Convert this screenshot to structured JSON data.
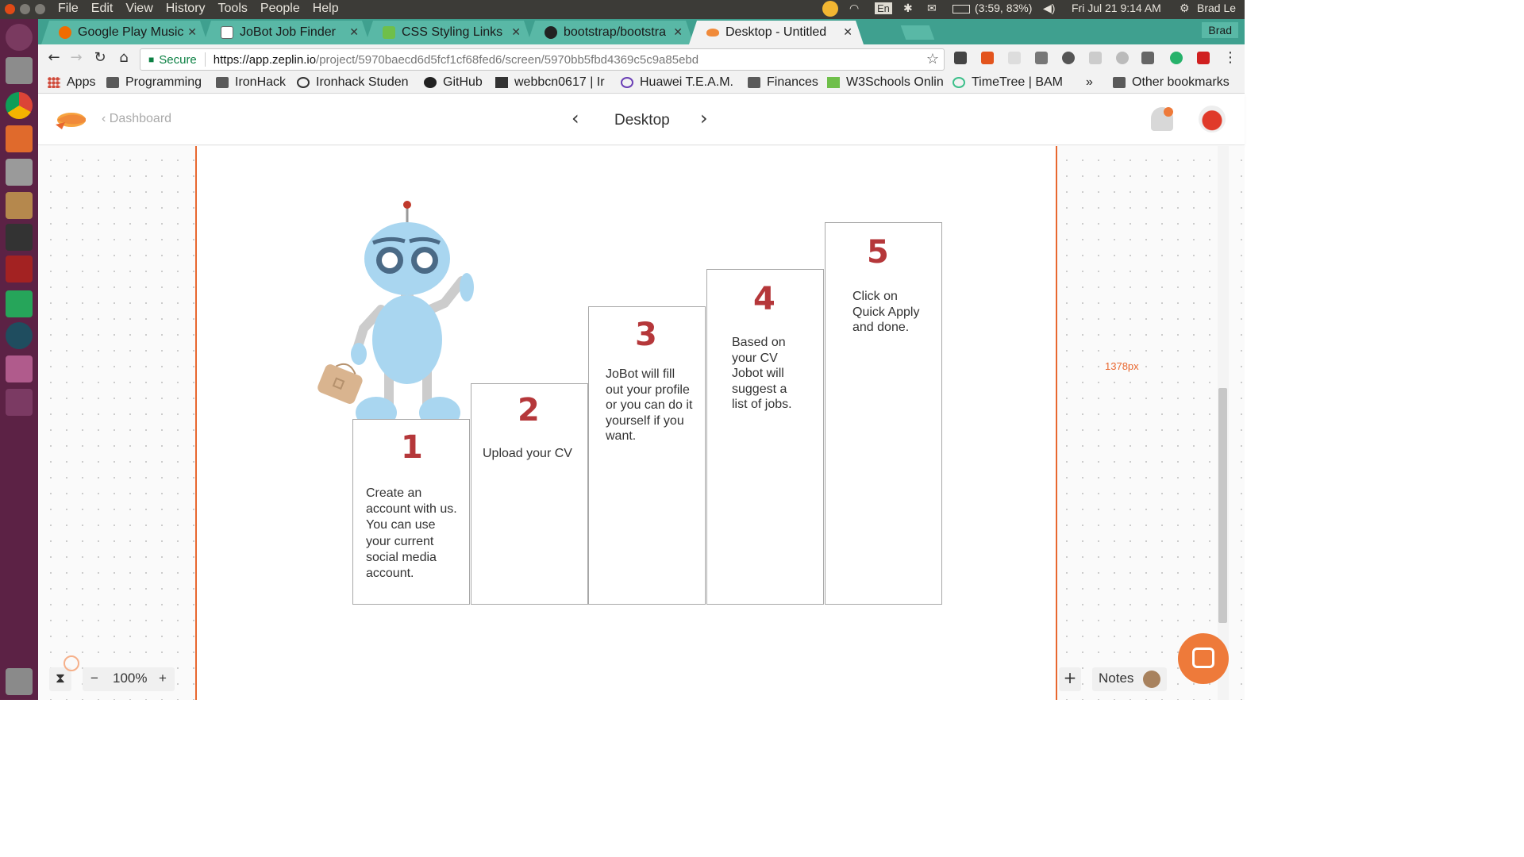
{
  "os": {
    "menus": [
      "File",
      "Edit",
      "View",
      "History",
      "Tools",
      "People",
      "Help"
    ],
    "keyboard": "En",
    "battery": "(3:59, 83%)",
    "datetime": "Fri Jul 21  9:14 AM",
    "user": "Brad Le"
  },
  "tabs": [
    {
      "label": "Google Play Music",
      "icon_color": "#ef6c00"
    },
    {
      "label": "JoBot Job Finder",
      "icon_color": "#888888"
    },
    {
      "label": "CSS Styling Links",
      "icon_color": "#6fbf4a"
    },
    {
      "label": "bootstrap/bootstra",
      "icon_color": "#222222"
    },
    {
      "label": "Desktop - Untitled",
      "icon_color": "#f08a3a"
    }
  ],
  "profile_name": "Brad",
  "address": {
    "secure_label": "Secure",
    "url_host": "https://app.zeplin.io",
    "url_path": "/project/5970baecd6d5fcf1cf68fed6/screen/5970bb5fbd4369c5c9a85ebd"
  },
  "bookmarks": [
    "Apps",
    "Programming",
    "IronHack",
    "Ironhack Studen",
    "GitHub",
    "webbcn0617 | Ir",
    "Huawei T.E.A.M.",
    "Finances",
    "W3Schools Onlin",
    "TimeTree | BAM",
    "»",
    "Other bookmarks"
  ],
  "zeplin": {
    "dashboard_label": "Dashboard",
    "screen_title": "Desktop",
    "width_label": "1378px",
    "zoom": "100%",
    "zoom_minus": "−",
    "zoom_plus": "+",
    "notes_label": "Notes",
    "add_label": "+"
  },
  "steps": [
    {
      "num": "1",
      "text": "Create an account with us. You can use your current social media account."
    },
    {
      "num": "2",
      "text": "Upload your CV"
    },
    {
      "num": "3",
      "text": "JoBot will fill out your profile or you can do it yourself if you want."
    },
    {
      "num": "4",
      "text": "Based on your CV Jobot will suggest a list of jobs."
    },
    {
      "num": "5",
      "text": "Click on Quick Apply and done."
    }
  ],
  "colors": {
    "accent": "#e8672f",
    "step_number": "#b5373a",
    "tabstrip": "#3fa08f",
    "launcher": "#5c2245"
  }
}
